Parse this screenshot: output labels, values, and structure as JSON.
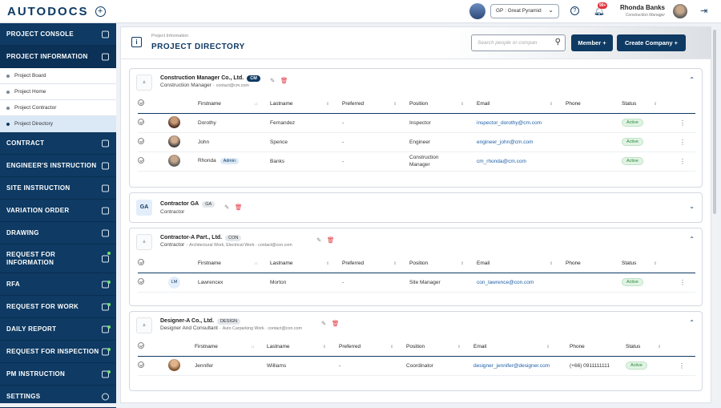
{
  "app": {
    "logo": "AUTODOCS",
    "project_select": "GP : Great Pyramid",
    "notification_count": "99+",
    "user_name": "Rhonda Banks",
    "user_role": "Construction Manager"
  },
  "sidebar": {
    "items": [
      {
        "label": "PROJECT CONSOLE",
        "icon": "sliders-icon"
      },
      {
        "label": "PROJECT INFORMATION",
        "icon": "info-book-icon"
      },
      {
        "label": "CONTRACT",
        "icon": "documents-icon"
      },
      {
        "label": "ENGINEER'S INSTRUCTION",
        "icon": "instruction-icon"
      },
      {
        "label": "SITE INSTRUCTION",
        "icon": "instruction-icon"
      },
      {
        "label": "VARIATION ORDER",
        "icon": "variation-icon"
      },
      {
        "label": "DRAWING",
        "icon": "drawing-icon"
      },
      {
        "label": "REQUEST FOR INFORMATION",
        "icon": "rfi-icon"
      },
      {
        "label": "RFA",
        "icon": "rfa-icon"
      },
      {
        "label": "REQUEST FOR WORK",
        "icon": "work-icon"
      },
      {
        "label": "DAILY REPORT",
        "icon": "report-icon"
      },
      {
        "label": "REQUEST FOR INSPECTION",
        "icon": "inspection-icon"
      },
      {
        "label": "PM INSTRUCTION",
        "icon": "pm-icon"
      },
      {
        "label": "SETTINGS",
        "icon": "gear-icon"
      }
    ],
    "sub_items": [
      "Project Board",
      "Project Home",
      "Project Contractor",
      "Project Directory"
    ]
  },
  "header": {
    "breadcrumb": "Project Information",
    "title": "PROJECT DIRECTORY",
    "search_placeholder": "Search people or compan",
    "member_button": "Member +",
    "create_company_button": "Create Company +"
  },
  "columns": {
    "firstname": "Firstname",
    "lastname": "Lastname",
    "preferred": "Preferred",
    "position": "Position",
    "email": "Email",
    "phone": "Phone",
    "status": "Status"
  },
  "companies": [
    {
      "name": "Construction Manager Co., Ltd.",
      "tag": "CM",
      "role": "Construction Manager",
      "detail": "contact@cm.com",
      "people": [
        {
          "firstname": "Dorothy",
          "lastname": "Fernandez",
          "preferred": "-",
          "position": "Inspector",
          "email": "inspector_dorothy@cm.com",
          "phone": "",
          "status": "Active"
        },
        {
          "firstname": "John",
          "lastname": "Spence",
          "preferred": "-",
          "position": "Engineer",
          "email": "engineer_john@cm.com",
          "phone": "",
          "status": "Active"
        },
        {
          "firstname": "Rhonda",
          "badge": "Admin",
          "lastname": "Banks",
          "preferred": "-",
          "position": "Construction Manager",
          "email": "cm_rhonda@cm.com",
          "phone": "",
          "status": "Active"
        }
      ]
    },
    {
      "name": "Contractor GA",
      "tag": "GA",
      "logo_text": "GA",
      "role": "Contractor",
      "detail": ""
    },
    {
      "name": "Contractor-A Part., Ltd.",
      "tag": "CON",
      "role": "Contractor",
      "detail": "Architectural Work, Electrical Work · contact@con.com",
      "people": [
        {
          "initials": "LM",
          "firstname": "Lawrencex",
          "lastname": "Morton",
          "preferred": "-",
          "position": "Site Manager",
          "email": "con_lawrence@con.com",
          "phone": "",
          "status": "Active"
        }
      ]
    },
    {
      "name": "Designer-A Co., Ltd.",
      "tag": "DESIGN",
      "role": "Designer And Consultant",
      "detail": "Auto Carparking Work · contact@con.com",
      "people": [
        {
          "firstname": "Jennifer",
          "lastname": "Williams",
          "preferred": "-",
          "position": "Coordinator",
          "email": "designer_jennifer@designer.com",
          "phone": "(+66) 0911111111",
          "status": "Active"
        }
      ]
    }
  ],
  "colors": {
    "primary": "#0e3a63",
    "danger": "#e2333d",
    "active_bg": "#e1f3e4",
    "link": "#1f5fa8"
  }
}
